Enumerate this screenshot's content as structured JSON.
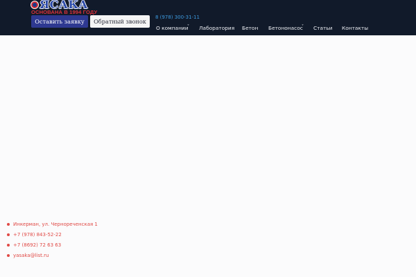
{
  "logo": {
    "name": "ЯСАКА",
    "tagline": "ОСНОВАНА В 1994 ГОДУ"
  },
  "header": {
    "request_button": "Оставить заявку",
    "callback_button": "Обратный звонок",
    "phone": "8 (978) 300-31-11"
  },
  "nav": {
    "items": [
      {
        "label": "О компании",
        "has_dropdown": true
      },
      {
        "label": "Лаборатория",
        "has_dropdown": false
      },
      {
        "label": "Бетон",
        "has_dropdown": false
      },
      {
        "label": "Бетононасос",
        "has_dropdown": true
      },
      {
        "label": "Статьи",
        "has_dropdown": false
      },
      {
        "label": "Контакты",
        "has_dropdown": false
      }
    ],
    "dropdown_glyph": "˅"
  },
  "contacts": [
    {
      "type": "address",
      "text": "Инкерман, ул. Чернореченская 1"
    },
    {
      "type": "phone",
      "text": "+7 (978) 843-52-22"
    },
    {
      "type": "phone",
      "text": "+7 (8692) 72 63 63"
    },
    {
      "type": "email",
      "text": "yasaka@list.ru"
    }
  ],
  "colors": {
    "header_bg": "#111a2a",
    "page_bg": "#fbfbfc",
    "request_button_bg": "#2e3991",
    "callback_button_bg": "#f5f5f5",
    "phone": "#3d9be0",
    "contact_text": "#e04945",
    "logo_blue": "#2b4aa8",
    "logo_red": "#d9323a"
  }
}
